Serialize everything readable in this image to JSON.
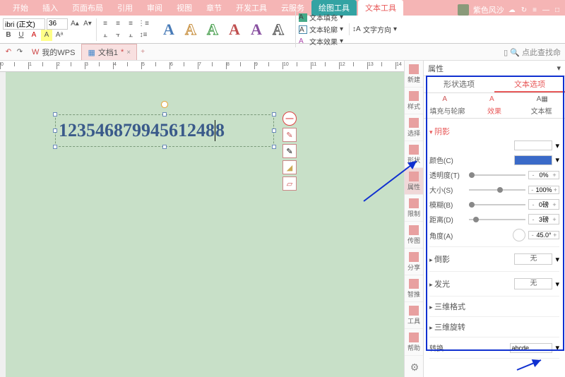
{
  "menu": {
    "items": [
      "开始",
      "插入",
      "页面布局",
      "引用",
      "审阅",
      "视图",
      "章节",
      "开发工具",
      "云服务"
    ],
    "context_tabs": [
      "绘图工具",
      "文本工具"
    ],
    "active": "文本工具"
  },
  "user": {
    "name": "紫色风沙"
  },
  "ribbon": {
    "font_name": "ibri (正文)",
    "font_size": "36",
    "text_fill": "文本填充",
    "text_outline": "文本轮廓",
    "text_effect": "文本效果",
    "text_direction": "文字方向"
  },
  "doc_tabs": {
    "home": "我的WPS",
    "doc": "文档1",
    "search_placeholder": "点此查找命"
  },
  "canvas": {
    "text_content": "12354687994561248"
  },
  "rail": {
    "items": [
      {
        "k": "new",
        "label": "新建"
      },
      {
        "k": "style",
        "label": "样式"
      },
      {
        "k": "select",
        "label": "选择"
      },
      {
        "k": "shape",
        "label": "形状"
      },
      {
        "k": "prop",
        "label": "属性"
      },
      {
        "k": "limit",
        "label": "限制"
      },
      {
        "k": "chuan",
        "label": "传图"
      },
      {
        "k": "share",
        "label": "分享"
      },
      {
        "k": "smart",
        "label": "智推"
      },
      {
        "k": "tool",
        "label": "工具"
      },
      {
        "k": "help",
        "label": "帮助"
      }
    ]
  },
  "panel": {
    "title": "属性",
    "tab_shape": "形状选项",
    "tab_text": "文本选项",
    "sub_fill": "填充与轮廓",
    "sub_effect": "效果",
    "sub_box": "文本框",
    "sections": {
      "shadow": "阴影",
      "color": "颜色(C)",
      "transparency": "透明度(T)",
      "transparency_val": "0%",
      "size": "大小(S)",
      "size_val": "100%",
      "blur": "模糊(B)",
      "blur_val": "0磅",
      "distance": "距离(D)",
      "distance_val": "3磅",
      "angle": "角度(A)",
      "angle_val": "45.0°",
      "reflection": "倒影",
      "glow": "发光",
      "none": "无",
      "format3d": "三维格式",
      "rotate3d": "三维旋转",
      "transform": "转换",
      "transform_val": "abcde"
    },
    "colors": {
      "shadow_preset": "#6a9ae8",
      "shadow_color": "#3a6ac8"
    }
  }
}
